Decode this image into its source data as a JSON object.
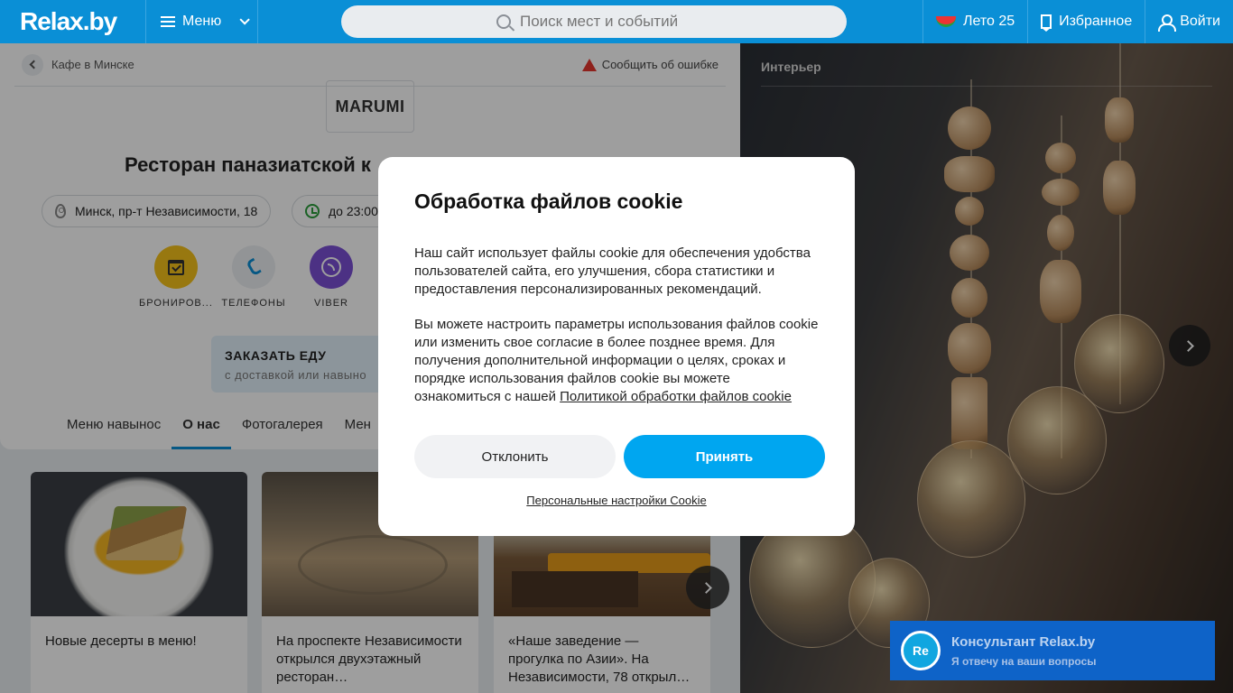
{
  "header": {
    "logo": "Relax.by",
    "menu_label": "Меню",
    "search_placeholder": "Поиск мест и событий",
    "summer_label": "Лето 25",
    "favorites_label": "Избранное",
    "login_label": "Войти"
  },
  "breadcrumb": {
    "back_label": "Кафе в Минске",
    "report_label": "Сообщить об ошибке"
  },
  "place": {
    "logo_text": "MARUMI",
    "title": "Ресторан паназиатской к",
    "address": "Минск, пр-т Независимости, 18",
    "hours": "до 23:00",
    "actions": [
      {
        "label": "БРОНИРОВ...",
        "icon": "calendar-check-icon",
        "color": "#f5c21b"
      },
      {
        "label": "ТЕЛЕФОНЫ",
        "icon": "phone-icon",
        "color": "#eceff2"
      },
      {
        "label": "VIBER",
        "icon": "viber-icon",
        "color": "#7b50d6"
      }
    ],
    "order": {
      "title": "ЗАКАЗАТЬ ЕДУ",
      "subtitle": "с доставкой или навыно"
    },
    "tabs": [
      "Меню навынос",
      "О нас",
      "Фотогалерея",
      "Мен"
    ]
  },
  "cards": [
    {
      "text": "Новые десерты в меню!"
    },
    {
      "text": "На проспекте Независимости открылся двухэтажный ресторан…"
    },
    {
      "text": "«Наше заведение — прогулка по Азии». На Независимости, 78 открыл…"
    }
  ],
  "gallery": {
    "heading": "Интерьер"
  },
  "cookie_modal": {
    "title": "Обработка файлов cookie",
    "paragraph1": "Наш сайт использует файлы cookie для обеспечения удобства пользователей сайта, его улучшения, сбора статистики и предоставления персонализированных рекомендаций.",
    "paragraph2": "Вы можете настроить параметры использования файлов cookie или изменить свое согласие в более позднее время. Для получения дополнительной информации о целях, сроках и порядке использования файлов cookie вы можете ознакомиться с нашей",
    "policy_link": "Политикой обработки файлов cookie",
    "decline_label": "Отклонить",
    "accept_label": "Принять",
    "settings_link": "Персональные настройки Cookie"
  },
  "consultant": {
    "avatar": "Re",
    "title": "Консультант Relax.by",
    "subtitle": "Я отвечу на ваши вопросы"
  },
  "colors": {
    "brand": "#0a8fd6",
    "accept": "#00a6f0",
    "consultant": "#0e63c8"
  }
}
